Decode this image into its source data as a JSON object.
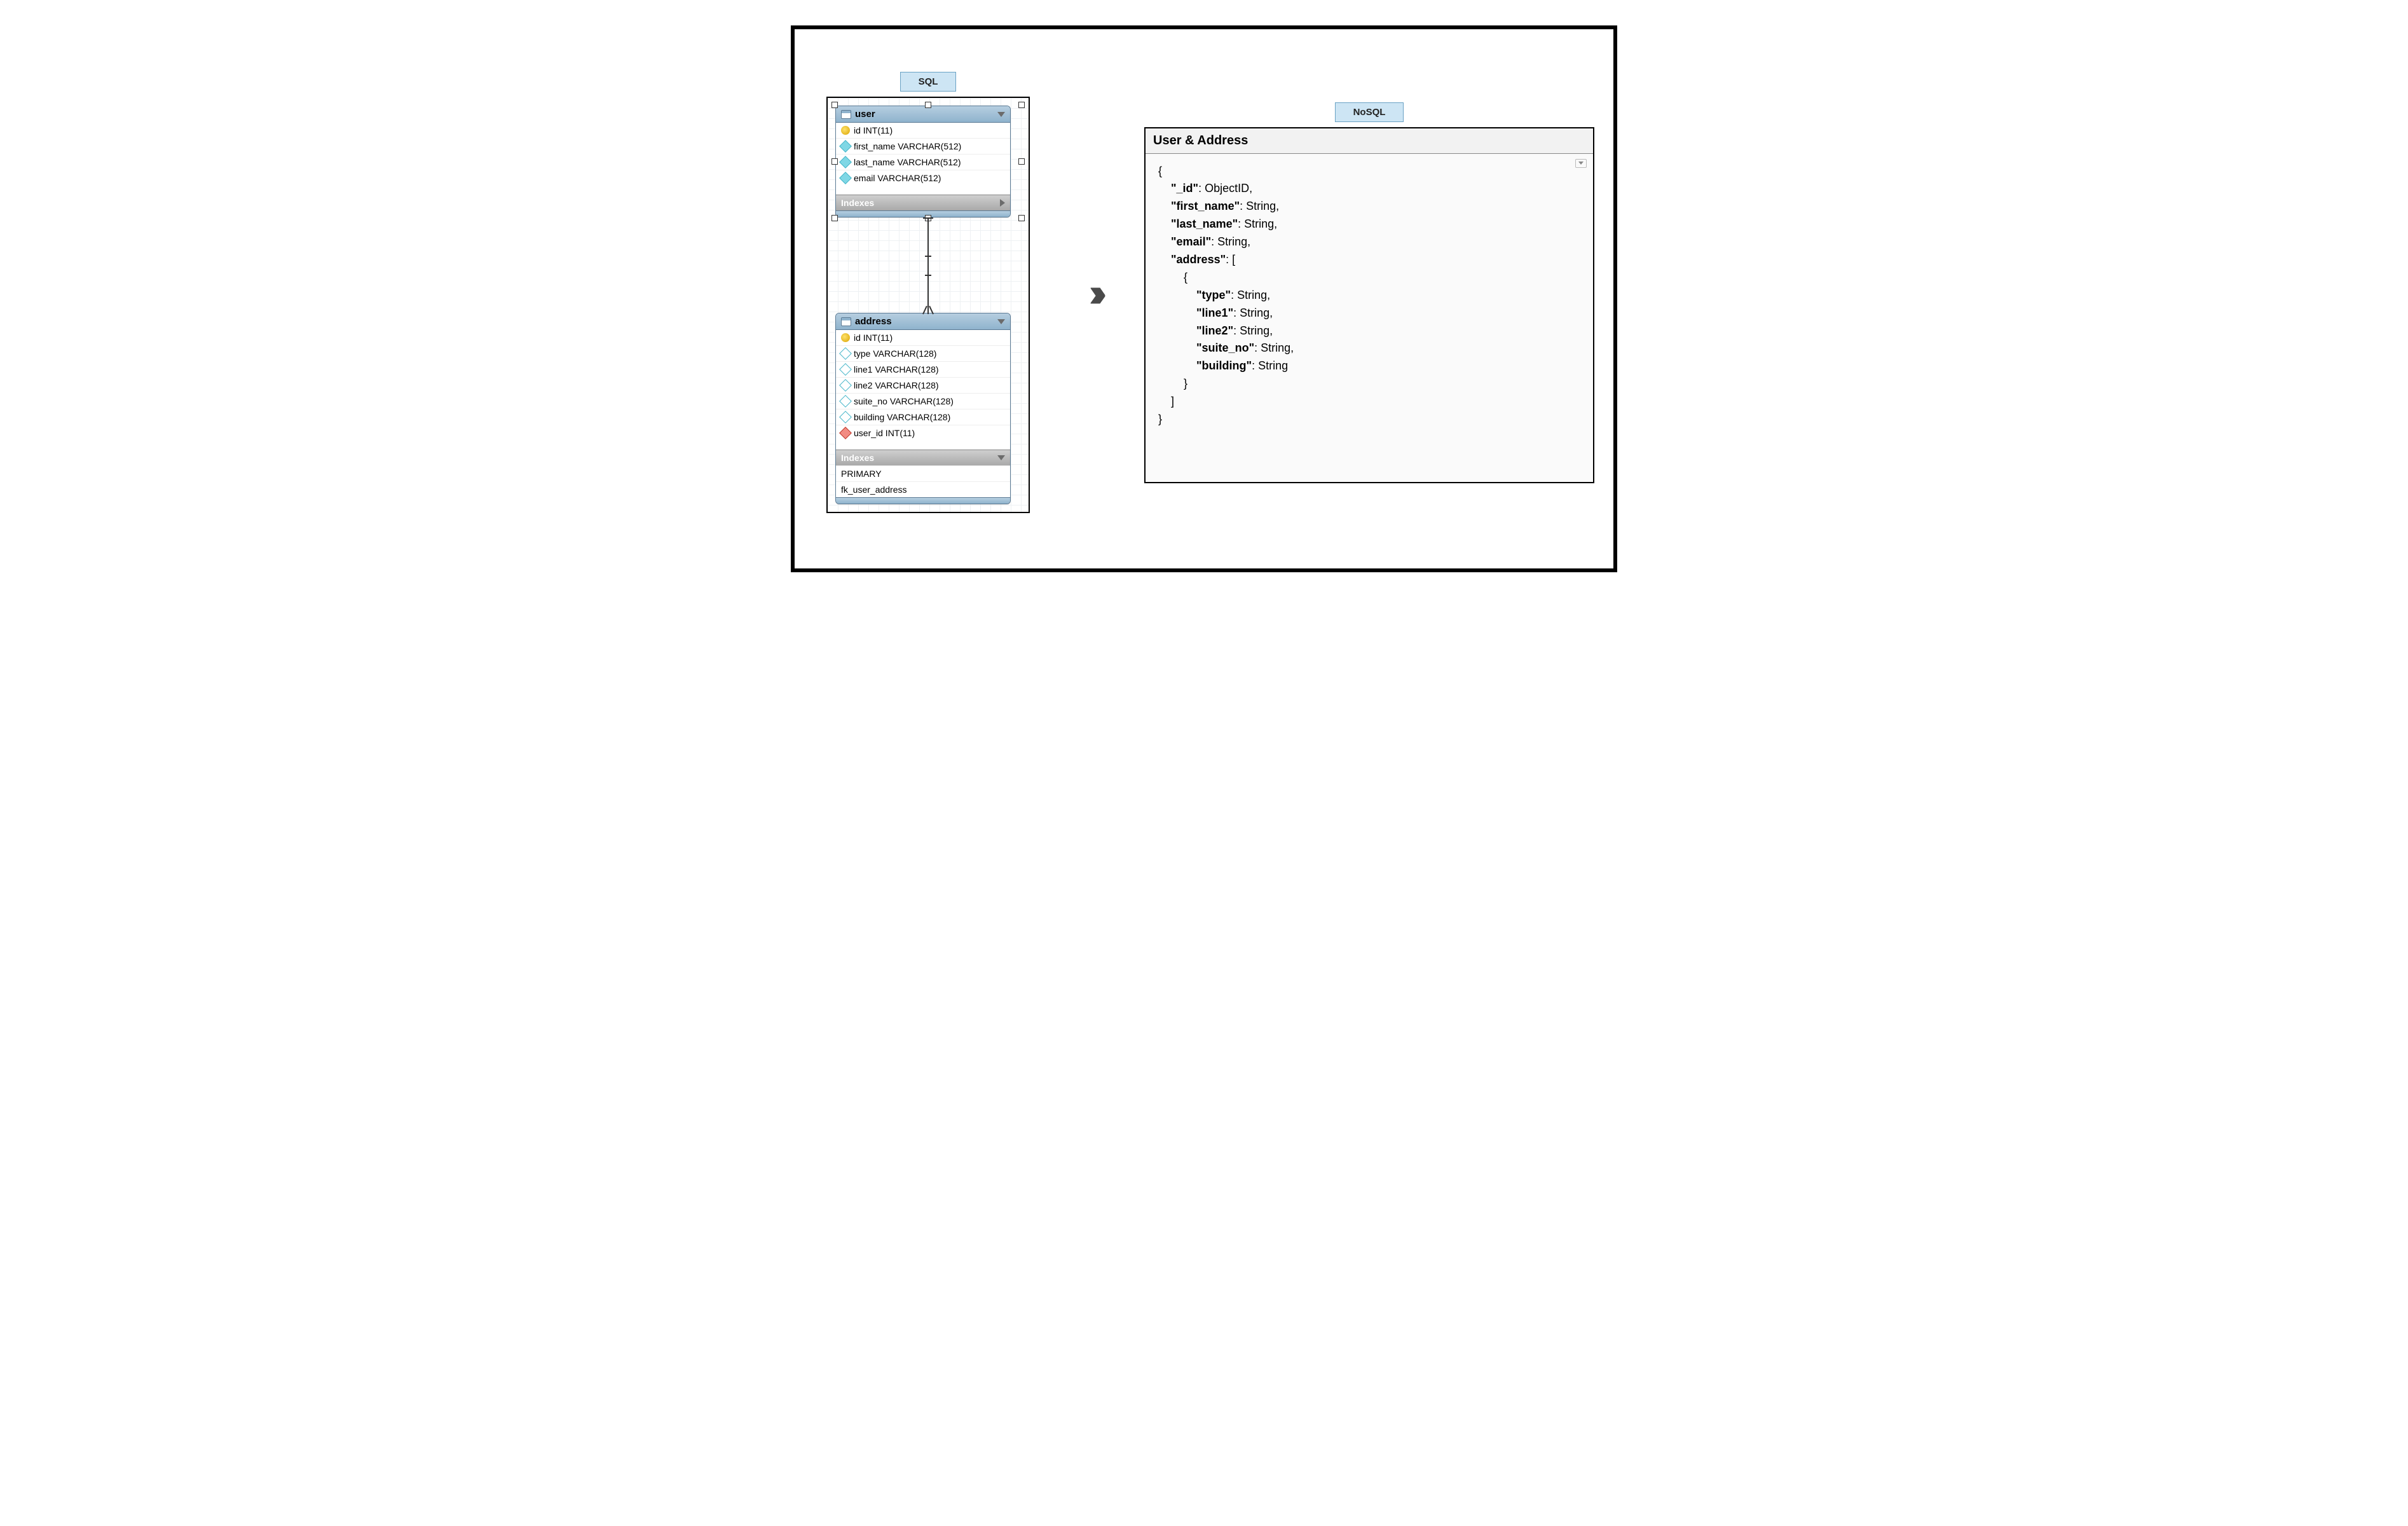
{
  "labels": {
    "sql": "SQL",
    "nosql": "NoSQL",
    "indexes": "Indexes"
  },
  "sql": {
    "tables": [
      {
        "name": "user",
        "selected": true,
        "columns": [
          {
            "name": "id",
            "type": "INT(11)",
            "icon": "key"
          },
          {
            "name": "first_name",
            "type": "VARCHAR(512)",
            "icon": "diamond-filled"
          },
          {
            "name": "last_name",
            "type": "VARCHAR(512)",
            "icon": "diamond-filled"
          },
          {
            "name": "email",
            "type": "VARCHAR(512)",
            "icon": "diamond-filled"
          }
        ],
        "indexesExpanded": false,
        "indexes": []
      },
      {
        "name": "address",
        "selected": false,
        "columns": [
          {
            "name": "id",
            "type": "INT(11)",
            "icon": "key"
          },
          {
            "name": "type",
            "type": "VARCHAR(128)",
            "icon": "diamond"
          },
          {
            "name": "line1",
            "type": "VARCHAR(128)",
            "icon": "diamond"
          },
          {
            "name": "line2",
            "type": "VARCHAR(128)",
            "icon": "diamond"
          },
          {
            "name": "suite_no",
            "type": "VARCHAR(128)",
            "icon": "diamond"
          },
          {
            "name": "building",
            "type": "VARCHAR(128)",
            "icon": "diamond"
          },
          {
            "name": "user_id",
            "type": "INT(11)",
            "icon": "fk"
          }
        ],
        "indexesExpanded": true,
        "indexes": [
          "PRIMARY",
          "fk_user_address"
        ]
      }
    ],
    "relationship": {
      "from": "user",
      "to": "address",
      "cardinality": "one-to-many"
    }
  },
  "nosql": {
    "title": "User & Address",
    "schema": [
      {
        "indent": 0,
        "text": "{"
      },
      {
        "indent": 1,
        "key": "_id",
        "value": "ObjectID,"
      },
      {
        "indent": 1,
        "key": "first_name",
        "value": "String,"
      },
      {
        "indent": 1,
        "key": "last_name",
        "value": "String,"
      },
      {
        "indent": 1,
        "key": "email",
        "value": "String,"
      },
      {
        "indent": 1,
        "key": "address",
        "value": "["
      },
      {
        "indent": 2,
        "text": "{"
      },
      {
        "indent": 3,
        "key": "type",
        "value": "String,"
      },
      {
        "indent": 3,
        "key": "line1",
        "value": "String,"
      },
      {
        "indent": 3,
        "key": "line2",
        "value": "String,"
      },
      {
        "indent": 3,
        "key": "suite_no",
        "value": "String,"
      },
      {
        "indent": 3,
        "key": "building",
        "value": "String"
      },
      {
        "indent": 2,
        "text": "}"
      },
      {
        "indent": 1,
        "text": "]"
      },
      {
        "indent": 0,
        "text": "}"
      }
    ]
  }
}
